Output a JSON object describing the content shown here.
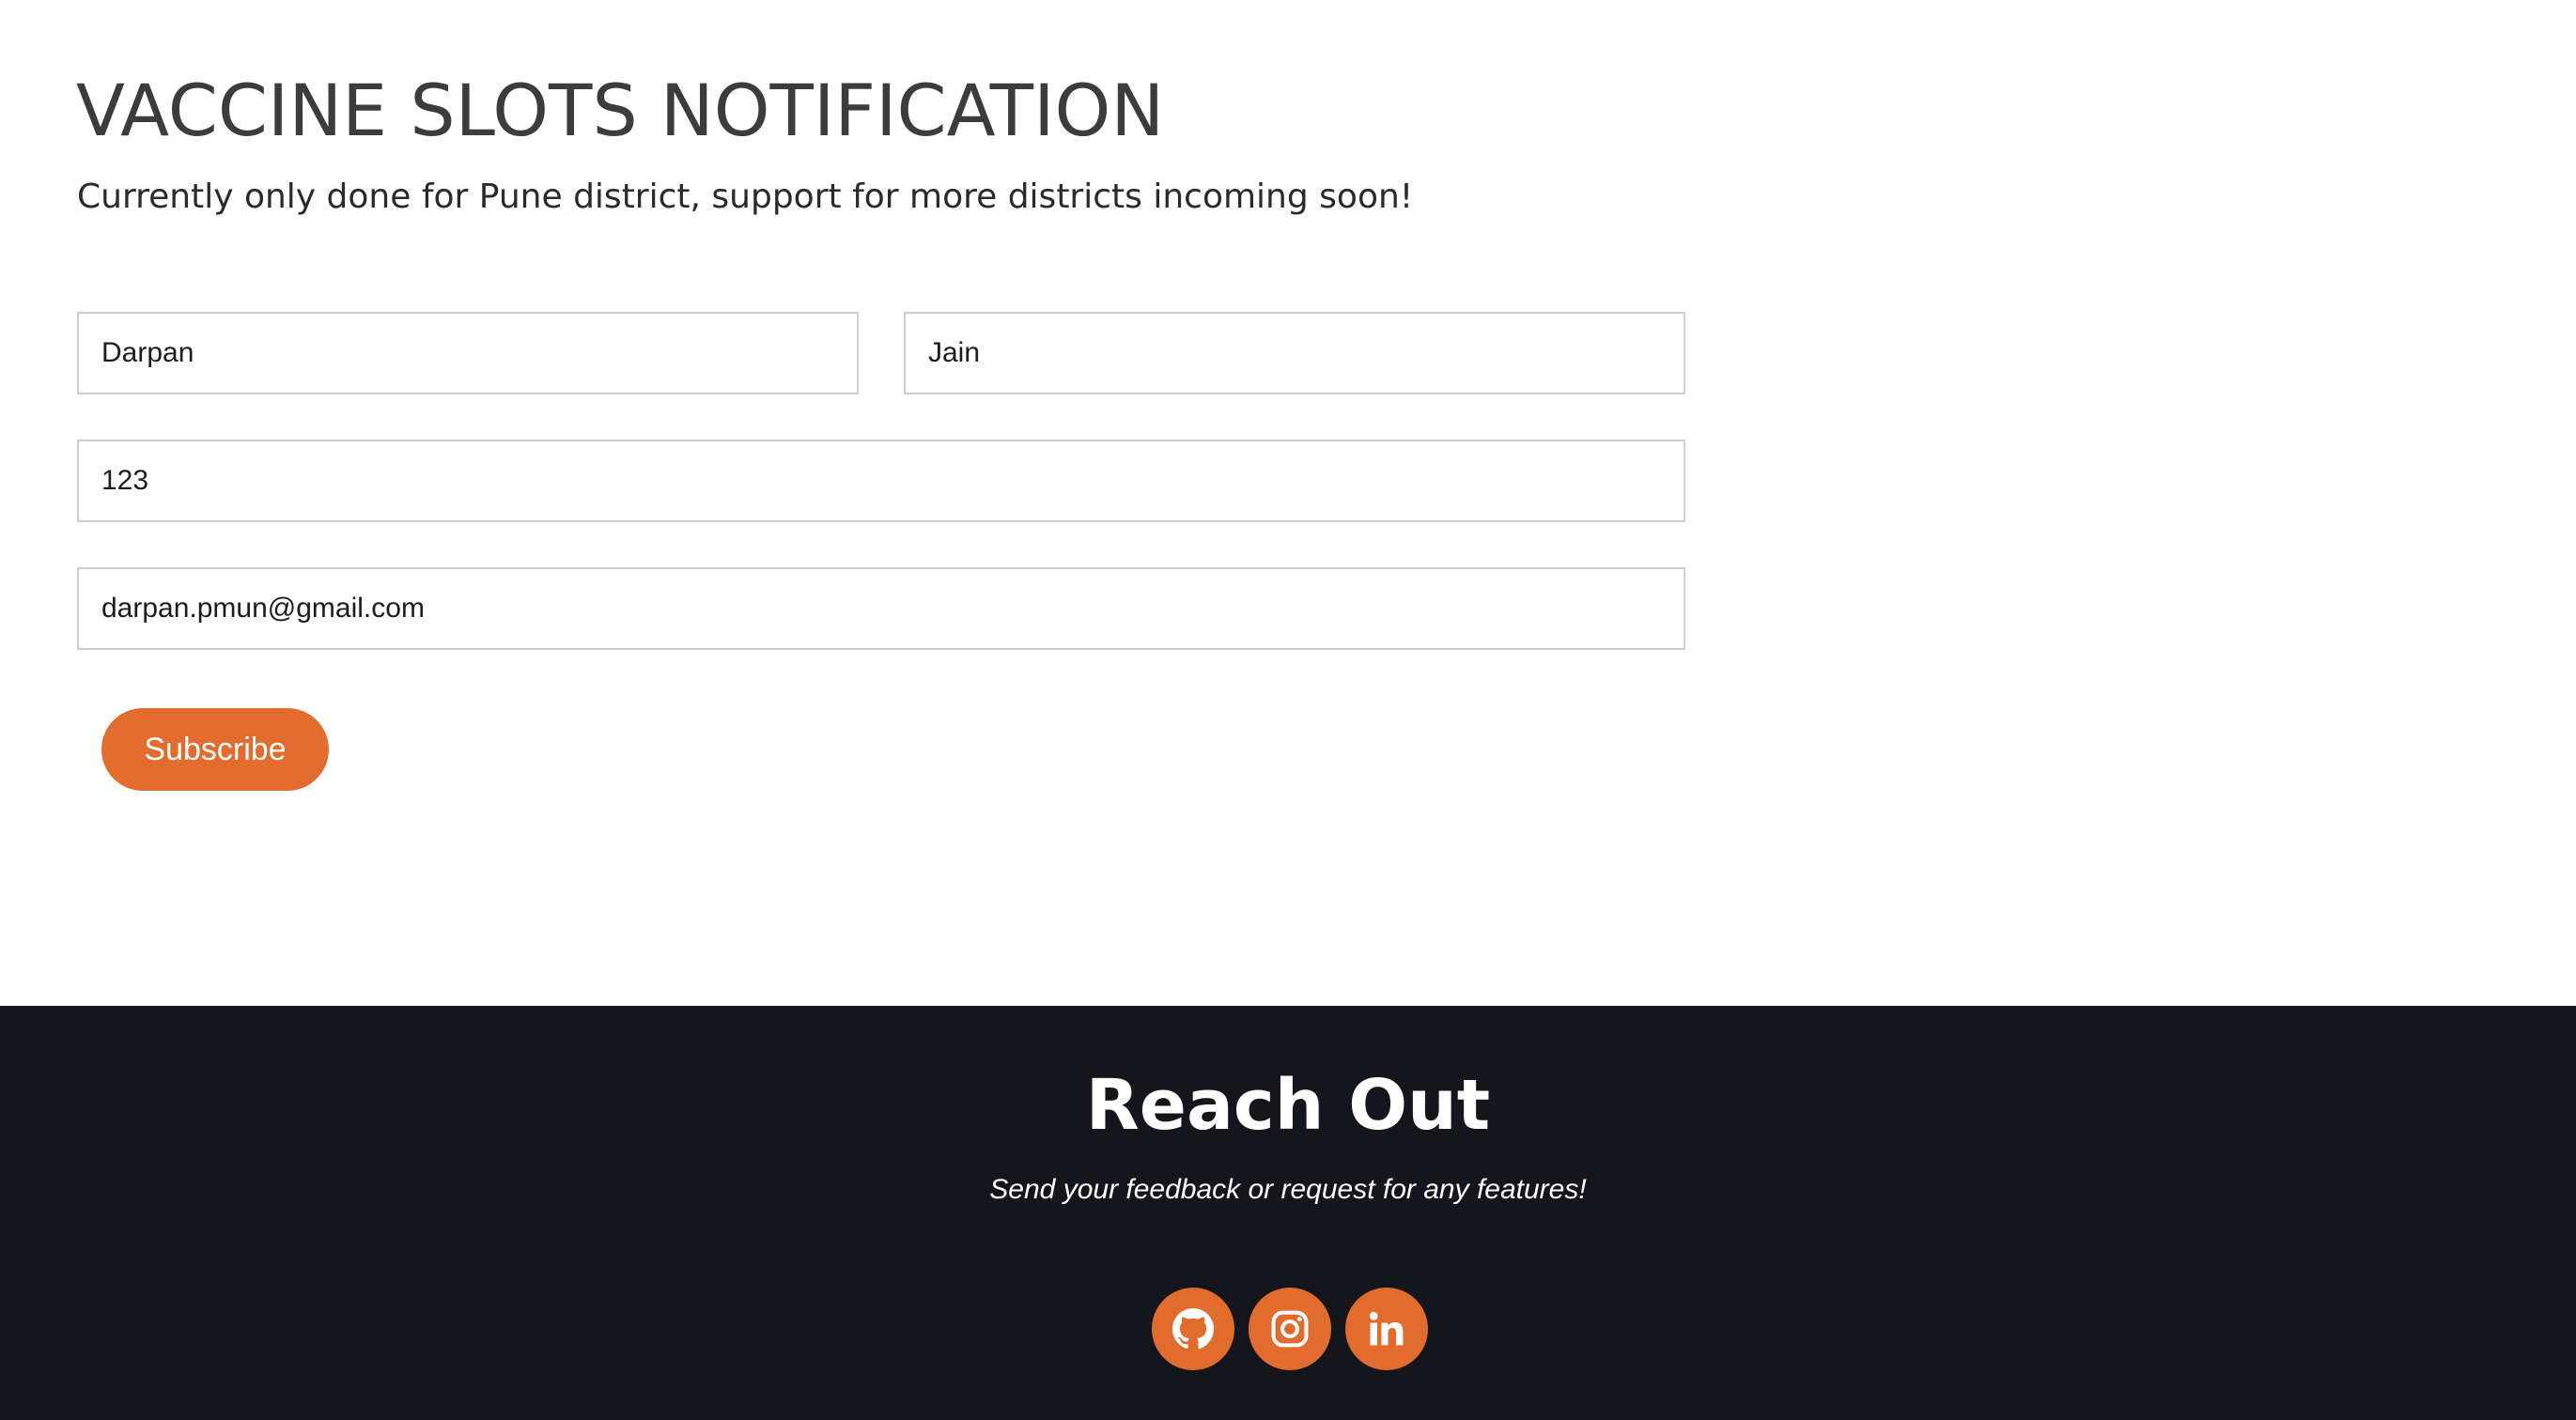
{
  "header": {
    "title": "VACCINE SLOTS NOTIFICATION",
    "subtitle": "Currently only done for Pune district, support for more districts incoming soon!"
  },
  "form": {
    "first_name": "Darpan",
    "last_name": "Jain",
    "pincode": "123",
    "email": "darpan.pmun@gmail.com",
    "subscribe_label": "Subscribe"
  },
  "footer": {
    "title": "Reach Out",
    "subtitle": "Send your feedback or request for any features!",
    "socials": [
      "github-icon",
      "instagram-icon",
      "linkedin-icon"
    ]
  },
  "colors": {
    "accent": "#e26c2d",
    "footer_bg": "#15161c",
    "title_text": "#3c3c3c"
  }
}
